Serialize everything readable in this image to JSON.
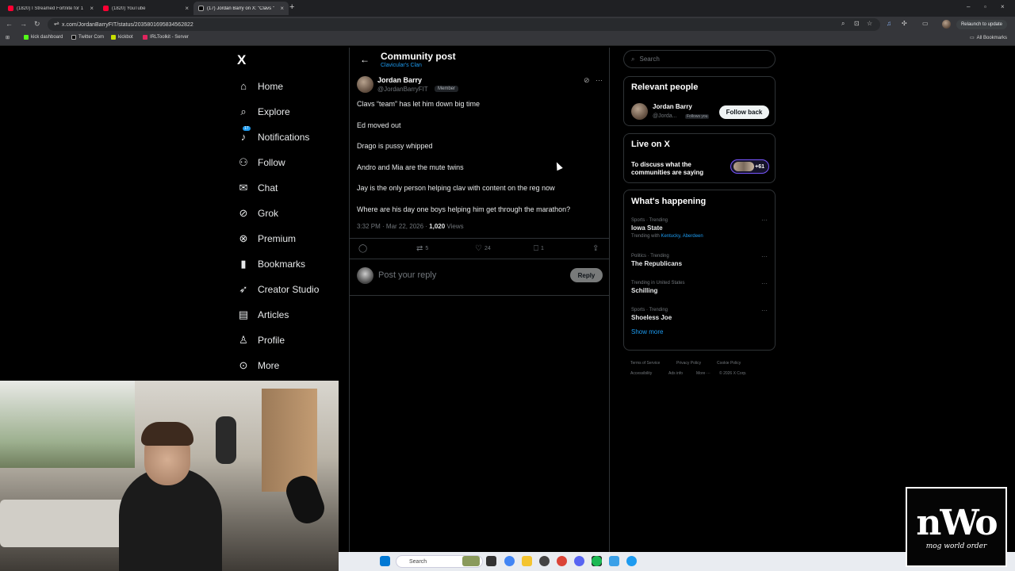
{
  "browser": {
    "tabs": [
      {
        "title": "(1820) I Streamed Fortnite for 1",
        "icon": "youtube-icon"
      },
      {
        "title": "(1820) YouTube",
        "icon": "youtube-icon"
      },
      {
        "title": "(17) Jordan Barry on X: \"Clavs \"",
        "icon": "x-icon"
      }
    ],
    "url": "x.com/JordanBarryFIT/status/2035801695834562822",
    "relaunch_label": "Relaunch to update",
    "bookmarks": [
      "kick dashboard",
      "Twitter Com",
      "kickbot",
      "IRLToolkit - Server"
    ],
    "all_bookmarks": "All Bookmarks"
  },
  "sidebar": {
    "logo": "X",
    "items": [
      {
        "label": "Home",
        "icon": "home-icon",
        "glyph": "⌂"
      },
      {
        "label": "Explore",
        "icon": "search-icon",
        "glyph": "⌕"
      },
      {
        "label": "Notifications",
        "icon": "bell-icon",
        "glyph": "♪",
        "badge": "17"
      },
      {
        "label": "Follow",
        "icon": "person-plus-icon",
        "glyph": "⚇"
      },
      {
        "label": "Chat",
        "icon": "mail-icon",
        "glyph": "✉"
      },
      {
        "label": "Grok",
        "icon": "grok-icon",
        "glyph": "⊘"
      },
      {
        "label": "Premium",
        "icon": "premium-icon",
        "glyph": "⊗"
      },
      {
        "label": "Bookmarks",
        "icon": "bookmark-icon",
        "glyph": "▮"
      },
      {
        "label": "Creator Studio",
        "icon": "rocket-icon",
        "glyph": "➶"
      },
      {
        "label": "Articles",
        "icon": "article-icon",
        "glyph": "▤"
      },
      {
        "label": "Profile",
        "icon": "profile-icon",
        "glyph": "♙"
      },
      {
        "label": "More",
        "icon": "more-icon",
        "glyph": "⊙"
      }
    ]
  },
  "post": {
    "header_title": "Community post",
    "community": "Clavicular's Clan",
    "author_name": "Jordan Barry",
    "author_handle": "@JordanBarryFIT",
    "member_label": "Member",
    "lines": [
      "Clavs “team” has let him down big time",
      "Ed moved out",
      "Drago is pussy whipped",
      "Andro and Mia are the mute twins",
      "Jay is the only person helping clav with content on the reg now",
      "Where are his day one boys helping him get through the marathon?"
    ],
    "timestamp": "3:32 PM · Mar 22, 2026 · ",
    "views_count": "1,020",
    "views_label": " Views",
    "retweets": "5",
    "likes": "24",
    "bookmarks": "1",
    "reply_placeholder": "Post your reply",
    "reply_button": "Reply"
  },
  "right": {
    "search_placeholder": "Search",
    "relevant_title": "Relevant people",
    "rp_name": "Jordan Barry",
    "rp_handle": "@Jorda...",
    "rp_follows_you": "Follows you",
    "follow_back": "Follow back",
    "live_title": "Live on X",
    "live_text": "To discuss what the communities are saying",
    "live_count": "+61",
    "happening_title": "What's happening",
    "trends": [
      {
        "category": "Sports · Trending",
        "name": "Iowa State",
        "with_label": "Trending with ",
        "with_links": "Kentucky, Aberdeen"
      },
      {
        "category": "Politics · Trending",
        "name": "The Republicans"
      },
      {
        "category": "Trending in United States",
        "name": "Schilling"
      },
      {
        "category": "Sports · Trending",
        "name": "Shoeless Joe"
      }
    ],
    "show_more": "Show more",
    "footer": [
      "Terms of Service",
      "Privacy Policy",
      "Cookie Policy",
      "Accessibility",
      "Ads info",
      "More ···",
      "© 2026 X Corp."
    ]
  },
  "taskbar": {
    "search_placeholder": "Search"
  },
  "overlay": {
    "logo_big": "nWo",
    "logo_small": "mog world order"
  }
}
